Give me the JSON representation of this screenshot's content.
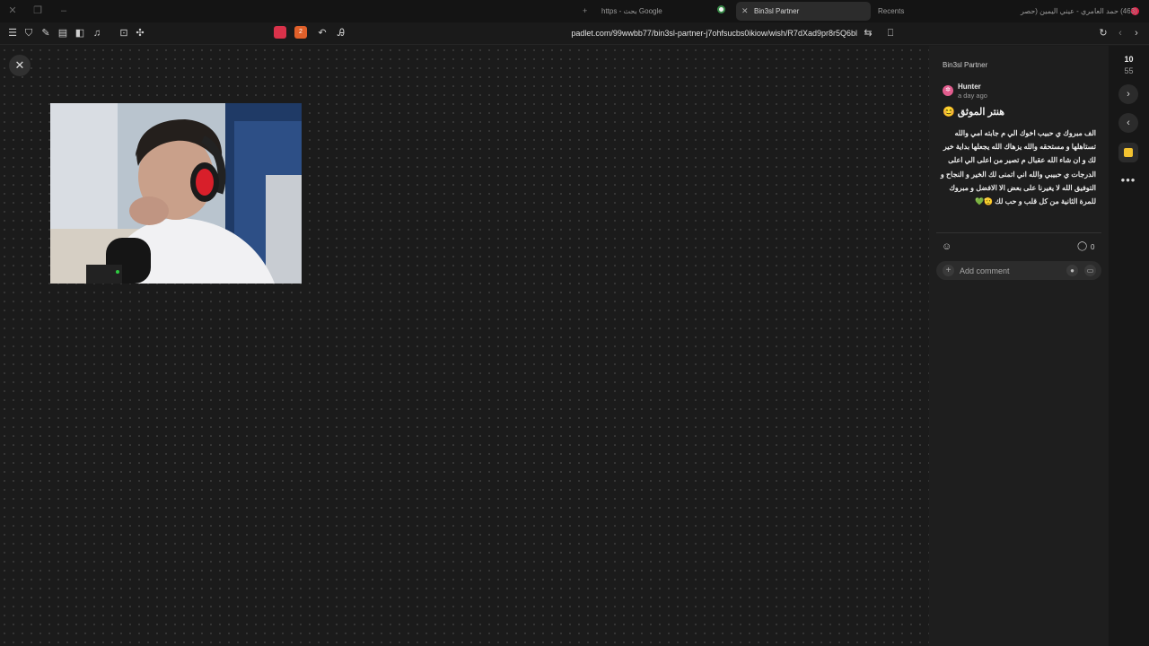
{
  "browser": {
    "tabs": [
      {
        "label": "(463) حمد العامري - عيني اليمين (حصر",
        "active": false
      },
      {
        "label": "Recents",
        "active": false
      },
      {
        "label": "Bin3sl Partner",
        "active": true
      },
      {
        "label": "https - بحث Google",
        "active": false
      }
    ],
    "url": "padlet.com/99wwbb77/bin3sl-partner-j7ohfsucbs0ikiow/wish/R7dXad9pr8r5Q6bl",
    "extension_badge": "2"
  },
  "panel": {
    "board_name": "Bin3sl Partner",
    "author": "Hunter",
    "avatar_glyph": "✲",
    "time": "a day ago",
    "post_title": "هنتر الموثق 😊",
    "post_body": "الف مبروك ي حبيب اخوك الي م جابته امي والله تستاهلها و مستحقه والله يزهاك الله يجعلها بداية خير لك و ان شاء الله عقبال م تصير من اعلى الي اعلى الدرجات ي حبيبي والله اني اتمنى لك الخير و النجاح و التوفيق الله لا يغيرنا على بعض الا الافضل و مبروك للمرة الثانية من كل قلب و حب لك 🫡💚",
    "comment_count": "0",
    "comment_placeholder": "Add comment"
  },
  "rail": {
    "counter_top": "10",
    "counter_bottom": "55"
  },
  "colors": {
    "accent_note": "#f2c230",
    "avatar": "#e25d8e",
    "canvas_bg": "#1b1b1b"
  }
}
